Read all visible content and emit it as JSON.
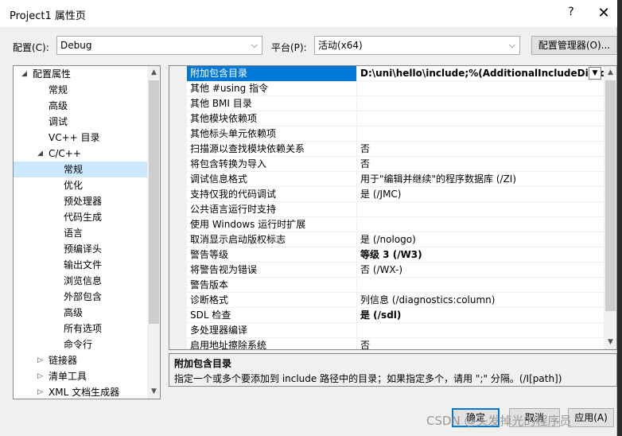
{
  "window": {
    "title": "Project1 属性页",
    "help_glyph": "?",
    "close_glyph": "✕"
  },
  "config": {
    "config_label": "配置(C):",
    "config_value": "Debug",
    "platform_label": "平台(P):",
    "platform_value": "活动(x64)",
    "manager_button": "配置管理器(O)..."
  },
  "tree": {
    "items": [
      {
        "label": "配置属性",
        "toggle": "◢"
      },
      {
        "label": "常规"
      },
      {
        "label": "高级"
      },
      {
        "label": "调试"
      },
      {
        "label": "VC++ 目录"
      },
      {
        "label": "C/C++",
        "toggle": "◢"
      },
      {
        "label": "常规"
      },
      {
        "label": "优化"
      },
      {
        "label": "预处理器"
      },
      {
        "label": "代码生成"
      },
      {
        "label": "语言"
      },
      {
        "label": "预编译头"
      },
      {
        "label": "输出文件"
      },
      {
        "label": "浏览信息"
      },
      {
        "label": "外部包含"
      },
      {
        "label": "高级"
      },
      {
        "label": "所有选项"
      },
      {
        "label": "命令行"
      },
      {
        "label": "链接器",
        "toggle": "▷"
      },
      {
        "label": "清单工具",
        "toggle": "▷"
      },
      {
        "label": "XML 文档生成器",
        "toggle": "▷"
      }
    ]
  },
  "grid": {
    "rows": [
      {
        "name": "附加包含目录",
        "value": "D:\\uni\\hello\\include;%(AdditionalIncludeDirectories)"
      },
      {
        "name": "其他 #using 指令",
        "value": ""
      },
      {
        "name": "其他 BMI 目录",
        "value": ""
      },
      {
        "name": "其他模块依赖项",
        "value": ""
      },
      {
        "name": "其他标头单元依赖项",
        "value": ""
      },
      {
        "name": "扫描源以查找模块依赖关系",
        "value": "否"
      },
      {
        "name": "将包含转换为导入",
        "value": "否"
      },
      {
        "name": "调试信息格式",
        "value": "用于\"编辑并继续\"的程序数据库 (/ZI)"
      },
      {
        "name": "支持仅我的代码调试",
        "value": "是 (/JMC)"
      },
      {
        "name": "公共语言运行时支持",
        "value": ""
      },
      {
        "name": "使用 Windows 运行时扩展",
        "value": ""
      },
      {
        "name": "取消显示启动版权标志",
        "value": "是 (/nologo)"
      },
      {
        "name": "警告等级",
        "value": "等级 3 (/W3)"
      },
      {
        "name": "将警告视为错误",
        "value": "否 (/WX-)"
      },
      {
        "name": "警告版本",
        "value": ""
      },
      {
        "name": "诊断格式",
        "value": "列信息 (/diagnostics:column)"
      },
      {
        "name": "SDL 检查",
        "value": "是 (/sdl)"
      },
      {
        "name": "多处理器编译",
        "value": ""
      },
      {
        "name": "启用地址擦除系统",
        "value": "否"
      }
    ]
  },
  "description": {
    "title": "附加包含目录",
    "text": "指定一个或多个要添加到 include 路径中的目录；如果指定多个，请用 \";\" 分隔。(/I[path])"
  },
  "buttons": {
    "ok": "确定",
    "cancel": "取消",
    "apply": "应用(A)"
  },
  "watermark": "CSDN @头发掉光的程序员",
  "colors": {
    "selection": "#0078d7",
    "tree_selection": "#cce8ff"
  }
}
